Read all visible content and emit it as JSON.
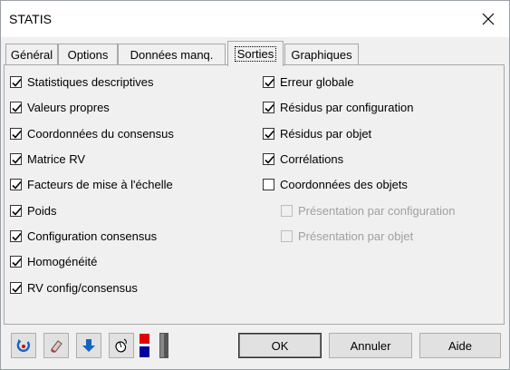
{
  "window": {
    "title": "STATIS"
  },
  "tabs": [
    {
      "label": "Général",
      "active": false
    },
    {
      "label": "Options",
      "active": false
    },
    {
      "label": "Données manq.",
      "active": false
    },
    {
      "label": "Sorties",
      "active": true
    },
    {
      "label": "Graphiques",
      "active": false
    }
  ],
  "left_options": [
    {
      "label": "Statistiques descriptives",
      "checked": true
    },
    {
      "label": "Valeurs propres",
      "checked": true
    },
    {
      "label": "Coordonnées du consensus",
      "checked": true
    },
    {
      "label": "Matrice RV",
      "checked": true
    },
    {
      "label": "Facteurs de mise à l'échelle",
      "checked": true
    },
    {
      "label": "Poids",
      "checked": true
    },
    {
      "label": "Configuration consensus",
      "checked": true
    },
    {
      "label": "Homogénéité",
      "checked": true
    },
    {
      "label": "RV config/consensus",
      "checked": true
    }
  ],
  "right_options": [
    {
      "label": "Erreur globale",
      "checked": true
    },
    {
      "label": "Résidus par configuration",
      "checked": true
    },
    {
      "label": "Résidus par objet",
      "checked": true
    },
    {
      "label": "Corrélations",
      "checked": true
    },
    {
      "label": "Coordonnées des objets",
      "checked": false
    }
  ],
  "sub_options": [
    {
      "label": "Présentation par configuration",
      "checked": false,
      "disabled": true
    },
    {
      "label": "Présentation par objet",
      "checked": false,
      "disabled": true
    }
  ],
  "toolbar_icons": [
    "reset-icon",
    "eraser-icon",
    "down-arrow-icon",
    "mouse-icon",
    "color-toggle-icon"
  ],
  "buttons": {
    "ok": "OK",
    "cancel": "Annuler",
    "help": "Aide"
  },
  "colors": {
    "accent_blue": "#1565c0",
    "red": "#e00000",
    "navy": "#0000a0"
  }
}
